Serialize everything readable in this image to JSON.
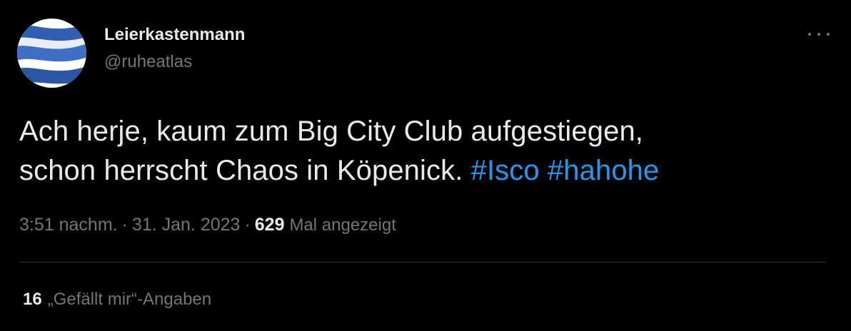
{
  "author": {
    "display_name": "Leierkastenmann",
    "handle": "@ruheatlas",
    "avatar_icon": "blue-white-striped-flag-avatar"
  },
  "more_icon": "more-dots-icon",
  "tweet": {
    "text_line1": "Ach herje, kaum zum Big City Club aufgestiegen,",
    "text_line2": "schon herrscht Chaos in Köpenick.",
    "hashtags": [
      "#Isco",
      "#hahohe"
    ]
  },
  "meta": {
    "time": "3:51 nachm.",
    "separator": "·",
    "date": "31. Jan. 2023",
    "views_count": "629",
    "views_label": "Mal angezeigt"
  },
  "likes": {
    "count": "16",
    "label": "„Gefällt mir“-Angaben"
  },
  "colors": {
    "background": "#000000",
    "text": "#e7e9ea",
    "secondary": "#71767b",
    "link": "#1d9bf0",
    "divider": "#2f3336"
  }
}
